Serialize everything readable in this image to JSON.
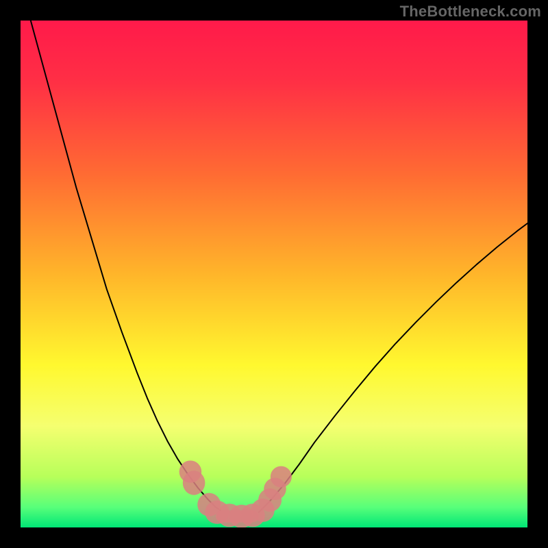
{
  "watermark": "TheBottleneck.com",
  "chart_data": {
    "type": "line",
    "title": "",
    "xlabel": "",
    "ylabel": "",
    "xlim": [
      0,
      100
    ],
    "ylim": [
      0,
      100
    ],
    "grid": false,
    "legend": false,
    "gradient_stops": [
      {
        "offset": 0.0,
        "color": "#ff1a4a"
      },
      {
        "offset": 0.12,
        "color": "#ff2f45"
      },
      {
        "offset": 0.3,
        "color": "#ff6a33"
      },
      {
        "offset": 0.5,
        "color": "#ffb52a"
      },
      {
        "offset": 0.68,
        "color": "#fff82f"
      },
      {
        "offset": 0.8,
        "color": "#f5ff70"
      },
      {
        "offset": 0.9,
        "color": "#b7ff5a"
      },
      {
        "offset": 0.96,
        "color": "#58ff7a"
      },
      {
        "offset": 1.0,
        "color": "#00e676"
      }
    ],
    "series": [
      {
        "name": "left-curve",
        "stroke": "#000000",
        "stroke_width": 2,
        "x": [
          2,
          5,
          8,
          11,
          14,
          17,
          20,
          23,
          25,
          27,
          29,
          31,
          33,
          35,
          37,
          38.5,
          40
        ],
        "y": [
          100,
          89,
          78,
          67,
          57,
          47,
          38.5,
          30.5,
          25.5,
          21,
          17,
          13.5,
          10.5,
          7.8,
          5.5,
          4,
          3
        ]
      },
      {
        "name": "right-curve",
        "stroke": "#000000",
        "stroke_width": 2,
        "x": [
          47,
          49,
          52,
          55,
          58,
          62,
          66,
          70,
          74,
          78,
          82,
          86,
          90,
          94,
          98,
          100
        ],
        "y": [
          3,
          5,
          8.5,
          12.5,
          16.8,
          22,
          27,
          31.8,
          36.3,
          40.5,
          44.5,
          48.3,
          51.9,
          55.3,
          58.5,
          60
        ]
      }
    ],
    "markers": {
      "name": "bottom-markers",
      "fill": "#d98080",
      "fill_opacity": 0.85,
      "points": [
        {
          "x": 33.5,
          "y": 11,
          "rx": 2.2,
          "ry": 2.2
        },
        {
          "x": 34.2,
          "y": 8.8,
          "rx": 2.2,
          "ry": 2.4
        },
        {
          "x": 37.2,
          "y": 4.5,
          "rx": 2.3,
          "ry": 2.3
        },
        {
          "x": 38.8,
          "y": 3.0,
          "rx": 2.4,
          "ry": 2.3
        },
        {
          "x": 41.2,
          "y": 2.4,
          "rx": 2.4,
          "ry": 2.3
        },
        {
          "x": 43.6,
          "y": 2.2,
          "rx": 2.4,
          "ry": 2.3
        },
        {
          "x": 45.8,
          "y": 2.4,
          "rx": 2.4,
          "ry": 2.3
        },
        {
          "x": 47.8,
          "y": 3.4,
          "rx": 2.3,
          "ry": 2.3
        },
        {
          "x": 49.2,
          "y": 5.4,
          "rx": 2.3,
          "ry": 2.3
        },
        {
          "x": 50.2,
          "y": 7.6,
          "rx": 2.2,
          "ry": 2.2
        },
        {
          "x": 51.4,
          "y": 10.0,
          "rx": 2.1,
          "ry": 2.1
        }
      ]
    },
    "bottom_bar": {
      "fill": "#d98080",
      "x0": 38.5,
      "x1": 47.0,
      "y": 2.2,
      "h": 2.4
    }
  }
}
